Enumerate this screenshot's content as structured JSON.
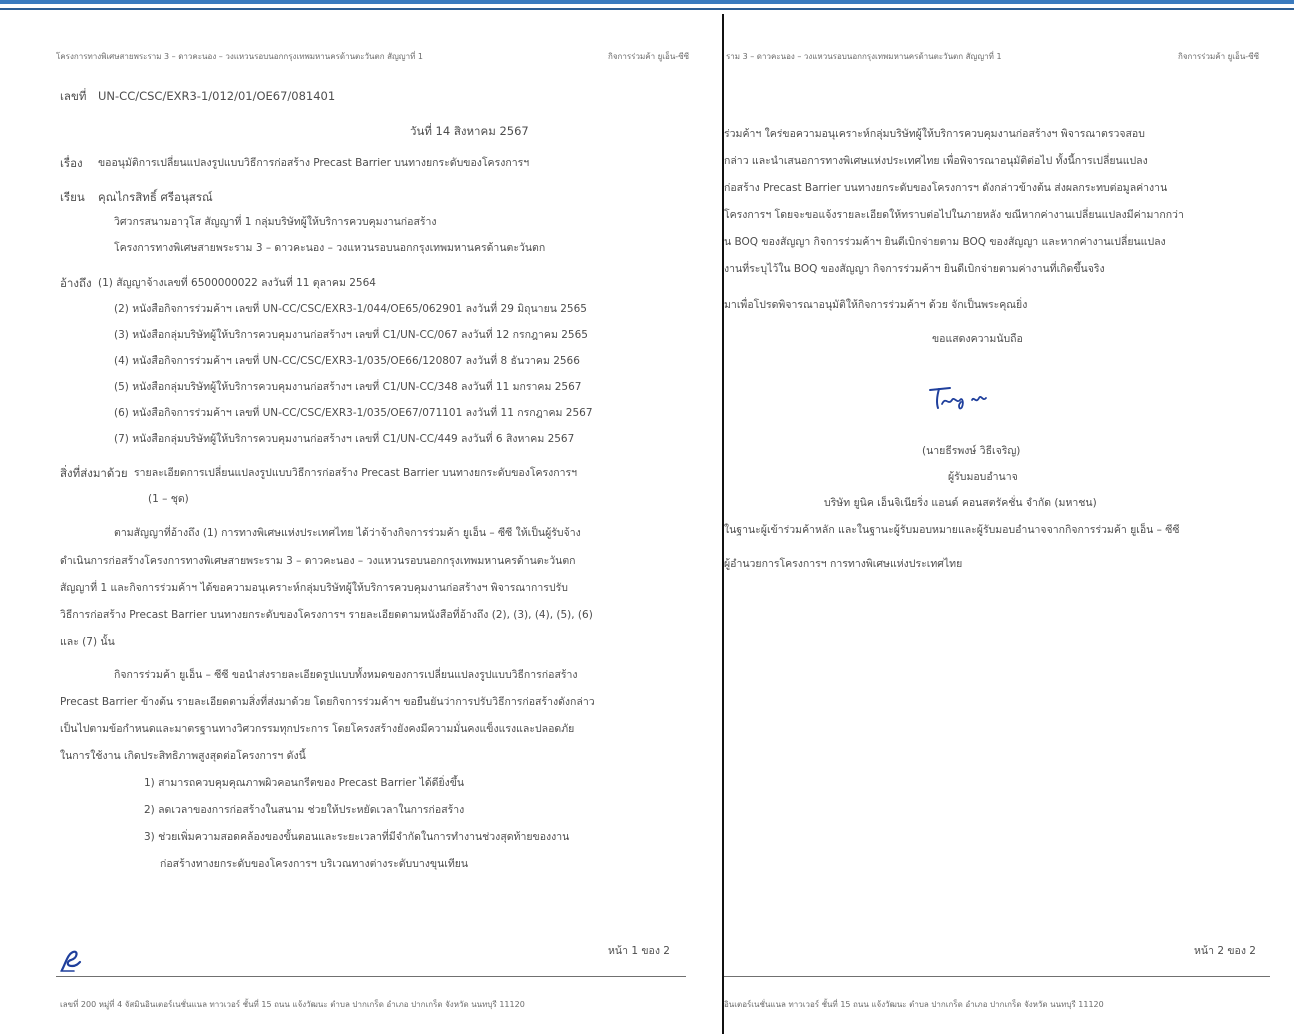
{
  "page1": {
    "header_left": "โครงการทางพิเศษสายพระราม 3 – ดาวคะนอง – วงแหวนรอบนอกกรุงเทพมหานครด้านตะวันตก สัญญาที่ 1",
    "header_right": "กิจการร่วมค้า ยูเอ็น-ซีซี",
    "ref_label": "เลขที่",
    "ref_no": "UN-CC/CSC/EXR3-1/012/01/OE67/081401",
    "date": "วันที่ 14 สิงหาคม 2567",
    "subject_label": "เรื่อง",
    "subject": "ขออนุมัติการเปลี่ยนแปลงรูปแบบวิธีการก่อสร้าง Precast Barrier บนทางยกระดับของโครงการฯ",
    "to_label": "เรียน",
    "to_name": "คุณไกรสิทธิ์ ศรีอนุสรณ์",
    "to_line2": "วิศวกรสนามอาวุโส สัญญาที่ 1 กลุ่มบริษัทผู้ให้บริการควบคุมงานก่อสร้าง",
    "to_line3": "โครงการทางพิเศษสายพระราม 3 – ดาวคะนอง – วงแหวนรอบนอกกรุงเทพมหานครด้านตะวันตก",
    "refs_label": "อ้างถึง",
    "refs": [
      "(1) สัญญาจ้างเลขที่ 6500000022 ลงวันที่ 11 ตุลาคม 2564",
      "(2) หนังสือกิจการร่วมค้าฯ เลขที่ UN-CC/CSC/EXR3-1/044/OE65/062901 ลงวันที่ 29 มิถุนายน 2565",
      "(3) หนังสือกลุ่มบริษัทผู้ให้บริการควบคุมงานก่อสร้างฯ เลขที่ C1/UN-CC/067 ลงวันที่ 12 กรกฎาคม 2565",
      "(4) หนังสือกิจการร่วมค้าฯ เลขที่ UN-CC/CSC/EXR3-1/035/OE66/120807 ลงวันที่ 8 ธันวาคม 2566",
      "(5) หนังสือกลุ่มบริษัทผู้ให้บริการควบคุมงานก่อสร้างฯ เลขที่ C1/UN-CC/348 ลงวันที่ 11 มกราคม 2567",
      "(6) หนังสือกิจการร่วมค้าฯ เลขที่ UN-CC/CSC/EXR3-1/035/OE67/071101 ลงวันที่ 11 กรกฎาคม 2567",
      "(7) หนังสือกลุ่มบริษัทผู้ให้บริการควบคุมงานก่อสร้างฯ เลขที่ C1/UN-CC/449 ลงวันที่ 6 สิงหาคม 2567"
    ],
    "encl_label": "สิ่งที่ส่งมาด้วย",
    "encl_line1": "รายละเอียดการเปลี่ยนแปลงรูปแบบวิธีการก่อสร้าง Precast Barrier บนทางยกระดับของโครงการฯ",
    "encl_line2": "(1 – ชุด)",
    "para1": [
      "ตามสัญญาที่อ้างถึง (1) การทางพิเศษแห่งประเทศไทย ได้ว่าจ้างกิจการร่วมค้า ยูเอ็น – ซีซี ให้เป็นผู้รับจ้าง",
      "ดำเนินการก่อสร้างโครงการทางพิเศษสายพระราม 3 – ดาวคะนอง – วงแหวนรอบนอกกรุงเทพมหานครด้านตะวันตก",
      "สัญญาที่ 1 และกิจการร่วมค้าฯ ได้ขอความอนุเคราะห์กลุ่มบริษัทผู้ให้บริการควบคุมงานก่อสร้างฯ พิจารณาการปรับ",
      "วิธีการก่อสร้าง Precast Barrier บนทางยกระดับของโครงการฯ รายละเอียดตามหนังสือที่อ้างถึง (2), (3), (4), (5), (6)",
      "และ (7) นั้น"
    ],
    "para2": [
      "กิจการร่วมค้า ยูเอ็น – ซีซี ขอนำส่งรายละเอียดรูปแบบทั้งหมดของการเปลี่ยนแปลงรูปแบบวิธีการก่อสร้าง",
      "Precast Barrier ข้างต้น รายละเอียดตามสิ่งที่ส่งมาด้วย โดยกิจการร่วมค้าฯ ขอยืนยันว่าการปรับวิธีการก่อสร้างดังกล่าว",
      "เป็นไปตามข้อกำหนดและมาตรฐานทางวิศวกรรมทุกประการ โดยโครงสร้างยังคงมีความมั่นคงแข็งแรงและปลอดภัย",
      "ในการใช้งาน เกิดประสิทธิภาพสูงสุดต่อโครงการฯ ดังนี้"
    ],
    "list": [
      "1) สามารถควบคุมคุณภาพผิวคอนกรีตของ Precast Barrier ได้ดียิ่งขึ้น",
      "2) ลดเวลาของการก่อสร้างในสนาม ช่วยให้ประหยัดเวลาในการก่อสร้าง",
      "3) ช่วยเพิ่มความสอดคล้องของขั้นตอนและระยะเวลาที่มีจำกัดในการทำงานช่วงสุดท้ายของงาน",
      "ก่อสร้างทางยกระดับของโครงการฯ บริเวณทางต่างระดับบางขุนเทียน"
    ],
    "page_no": "หน้า 1 ของ 2",
    "footer": "เลขที่ 200 หมู่ที่ 4 จัสมินอินเตอร์เนชั่นแนล ทาวเวอร์ ชั้นที่ 15 ถนน แจ้งวัฒนะ ตำบล ปากเกร็ด อำเภอ ปากเกร็ด จังหวัด นนทบุรี 11120"
  },
  "page2": {
    "header_left": "ราม 3 – ดาวคะนอง – วงแหวนรอบนอกกรุงเทพมหานครด้านตะวันตก สัญญาที่ 1",
    "header_right": "กิจการร่วมค้า ยูเอ็น-ซีซี",
    "para": [
      "ร่วมค้าฯ ใคร่ขอความอนุเคราะห์กลุ่มบริษัทผู้ให้บริการควบคุมงานก่อสร้างฯ พิจารณาตรวจสอบ",
      "กล่าว และนำเสนอการทางพิเศษแห่งประเทศไทย เพื่อพิจารณาอนุมัติต่อไป ทั้งนี้การเปลี่ยนแปลง",
      "ก่อสร้าง Precast Barrier บนทางยกระดับของโครงการฯ ดังกล่าวข้างต้น ส่งผลกระทบต่อมูลค่างาน",
      "โครงการฯ โดยจะขอแจ้งรายละเอียดให้ทราบต่อไปในภายหลัง ขณีหากค่างานเปลี่ยนแปลงมีค่ามากกว่า",
      "น BOQ ของสัญญา กิจการร่วมค้าฯ ยินดีเบิกจ่ายตาม BOQ ของสัญญา และหากค่างานเปลี่ยนแปลง",
      "งานที่ระบุไว้ใน BOQ ของสัญญา กิจการร่วมค้าฯ ยินดีเบิกจ่ายตามค่างานที่เกิดขึ้นจริง"
    ],
    "closing": "มาเพื่อโปรดพิจารณาอนุมัติให้กิจการร่วมค้าฯ ด้วย จักเป็นพระคุณยิ่ง",
    "regards": "ขอแสดงความนับถือ",
    "signer_name": "(นายธีรพงษ์ วิธีเจริญ)",
    "signer_title": "ผู้รับมอบอำนาจ",
    "company": "บริษัท ยูนิค เอ็นจิเนียริ่ง แอนด์ คอนสตรัคชั่น จำกัด (มหาชน)",
    "capacity": "ในฐานะผู้เข้าร่วมค้าหลัก และในฐานะผู้รับมอบหมายและผู้รับมอบอำนาจจากกิจการร่วมค้า ยูเอ็น – ซีซี",
    "cc": "ผู้อำนวยการโครงการฯ การทางพิเศษแห่งประเทศไทย",
    "page_no": "หน้า 2 ของ 2",
    "footer": "อินเตอร์เนชั่นแนล ทาวเวอร์ ชั้นที่ 15 ถนน แจ้งวัฒนะ ตำบล ปากเกร็ด อำเภอ ปากเกร็ด จังหวัด นนทบุรี 11120"
  },
  "colors": {
    "top_border": "#3b7bbf",
    "signature_ink": "#1f3f9c"
  }
}
